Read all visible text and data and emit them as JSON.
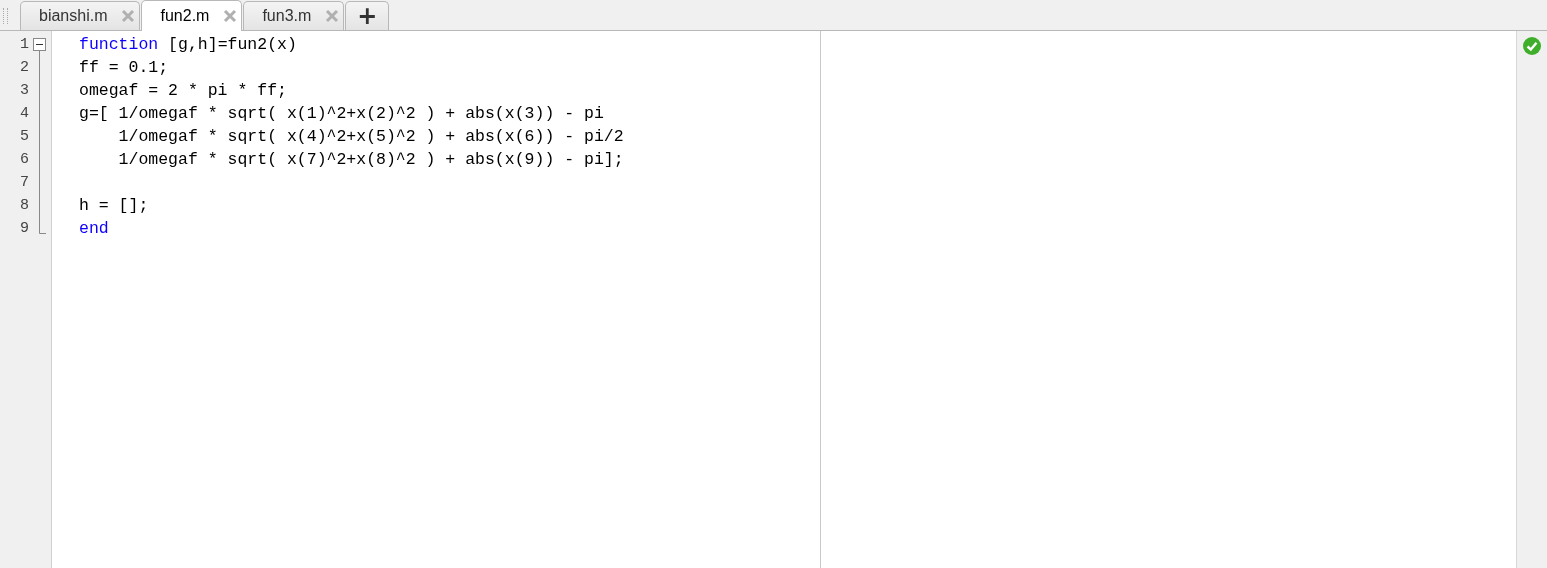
{
  "tabs": [
    {
      "label": "bianshi.m",
      "selected": false
    },
    {
      "label": "fun2.m",
      "selected": true
    },
    {
      "label": "fun3.m",
      "selected": false
    }
  ],
  "new_tab": "+",
  "editor": {
    "lines": [
      {
        "number": "1",
        "tokens": [
          {
            "kind": "keyword",
            "text": "function"
          },
          {
            "kind": "plain",
            "text": " [g,h]=fun2(x)"
          }
        ]
      },
      {
        "number": "2",
        "tokens": [
          {
            "kind": "plain",
            "text": "ff = 0.1;"
          }
        ]
      },
      {
        "number": "3",
        "tokens": [
          {
            "kind": "plain",
            "text": "omegaf = 2 * pi * ff;"
          }
        ]
      },
      {
        "number": "4",
        "tokens": [
          {
            "kind": "plain",
            "text": "g=[ 1/omegaf * sqrt( x(1)^2+x(2)^2 ) + abs(x(3)) - pi"
          }
        ]
      },
      {
        "number": "5",
        "tokens": [
          {
            "kind": "plain",
            "text": "    1/omegaf * sqrt( x(4)^2+x(5)^2 ) + abs(x(6)) - pi/2"
          }
        ]
      },
      {
        "number": "6",
        "tokens": [
          {
            "kind": "plain",
            "text": "    1/omegaf * sqrt( x(7)^2+x(8)^2 ) + abs(x(9)) - pi];"
          }
        ]
      },
      {
        "number": "7"
      },
      {
        "number": "8",
        "tokens": [
          {
            "kind": "plain",
            "text": "h = [];"
          }
        ]
      },
      {
        "number": "9",
        "tokens": [
          {
            "kind": "keyword",
            "text": "end"
          }
        ]
      }
    ],
    "fold_expanded": true,
    "valid": true
  }
}
